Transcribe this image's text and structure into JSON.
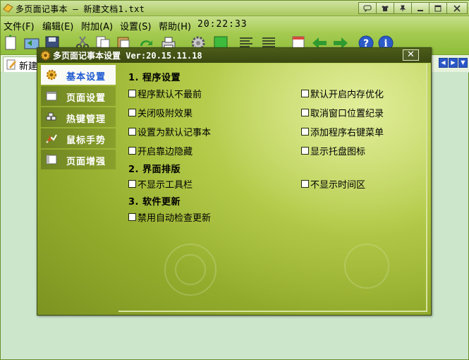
{
  "window": {
    "title": "多页面记事本 — 新建文档1.txt",
    "controls": [
      "chat-icon",
      "shirt-icon",
      "pin-icon",
      "minimize-icon",
      "maximize-icon",
      "close-icon"
    ]
  },
  "menu": {
    "items": [
      {
        "label": "文件(F)"
      },
      {
        "label": "编辑(E)"
      },
      {
        "label": "附加(A)"
      },
      {
        "label": "设置(S)"
      },
      {
        "label": "帮助(H)"
      }
    ],
    "clock": "20:22:33"
  },
  "toolbar": {
    "icons": [
      "new-file-icon",
      "open-icon",
      "save-icon",
      "cut-icon",
      "copy-icon",
      "paste-icon",
      "redo-icon",
      "print-icon",
      "settings-icon",
      "color-icon",
      "align-left-icon",
      "align-justify-icon",
      "note-icon",
      "back-arrow-icon",
      "forward-arrow-icon",
      "help-icon",
      "info-icon"
    ]
  },
  "tabs": {
    "active_label": "新建"
  },
  "dialog": {
    "title": "多页面记事本设置   Ver:20.15.11.18",
    "close_label": "✕",
    "nav": [
      {
        "label": "基本设置",
        "icon": "gear-icon",
        "active": true
      },
      {
        "label": "页面设置",
        "icon": "page-icon",
        "active": false
      },
      {
        "label": "热键管理",
        "icon": "hotkey-icon",
        "active": false
      },
      {
        "label": "鼠标手势",
        "icon": "gesture-icon",
        "active": false
      },
      {
        "label": "页面增强",
        "icon": "page-enhance-icon",
        "active": false
      }
    ],
    "sections": [
      {
        "heading": "1. 程序设置",
        "options": [
          {
            "label": "程序默认不最前",
            "checked": false
          },
          {
            "label": "默认开启内存优化",
            "checked": false
          },
          {
            "label": "关闭吸附效果",
            "checked": false
          },
          {
            "label": "取消窗口位置纪录",
            "checked": false
          },
          {
            "label": "设置为默认记事本",
            "checked": false
          },
          {
            "label": "添加程序右键菜单",
            "checked": false
          },
          {
            "label": "开启靠边隐藏",
            "checked": false
          },
          {
            "label": "显示托盘图标",
            "checked": false
          }
        ]
      },
      {
        "heading": "2. 界面排版",
        "options": [
          {
            "label": "不显示工具栏",
            "checked": false
          },
          {
            "label": "不显示时间区",
            "checked": false
          }
        ]
      },
      {
        "heading": "3. 软件更新",
        "options": [
          {
            "label": "禁用自动检查更新",
            "checked": false
          }
        ]
      }
    ]
  },
  "colors": {
    "dialog_titlebar": "#3a4811",
    "dialog_bg": "#a3bb38",
    "active_nav_text": "#1f5bd2",
    "editor_bg": "#cce6cc"
  }
}
